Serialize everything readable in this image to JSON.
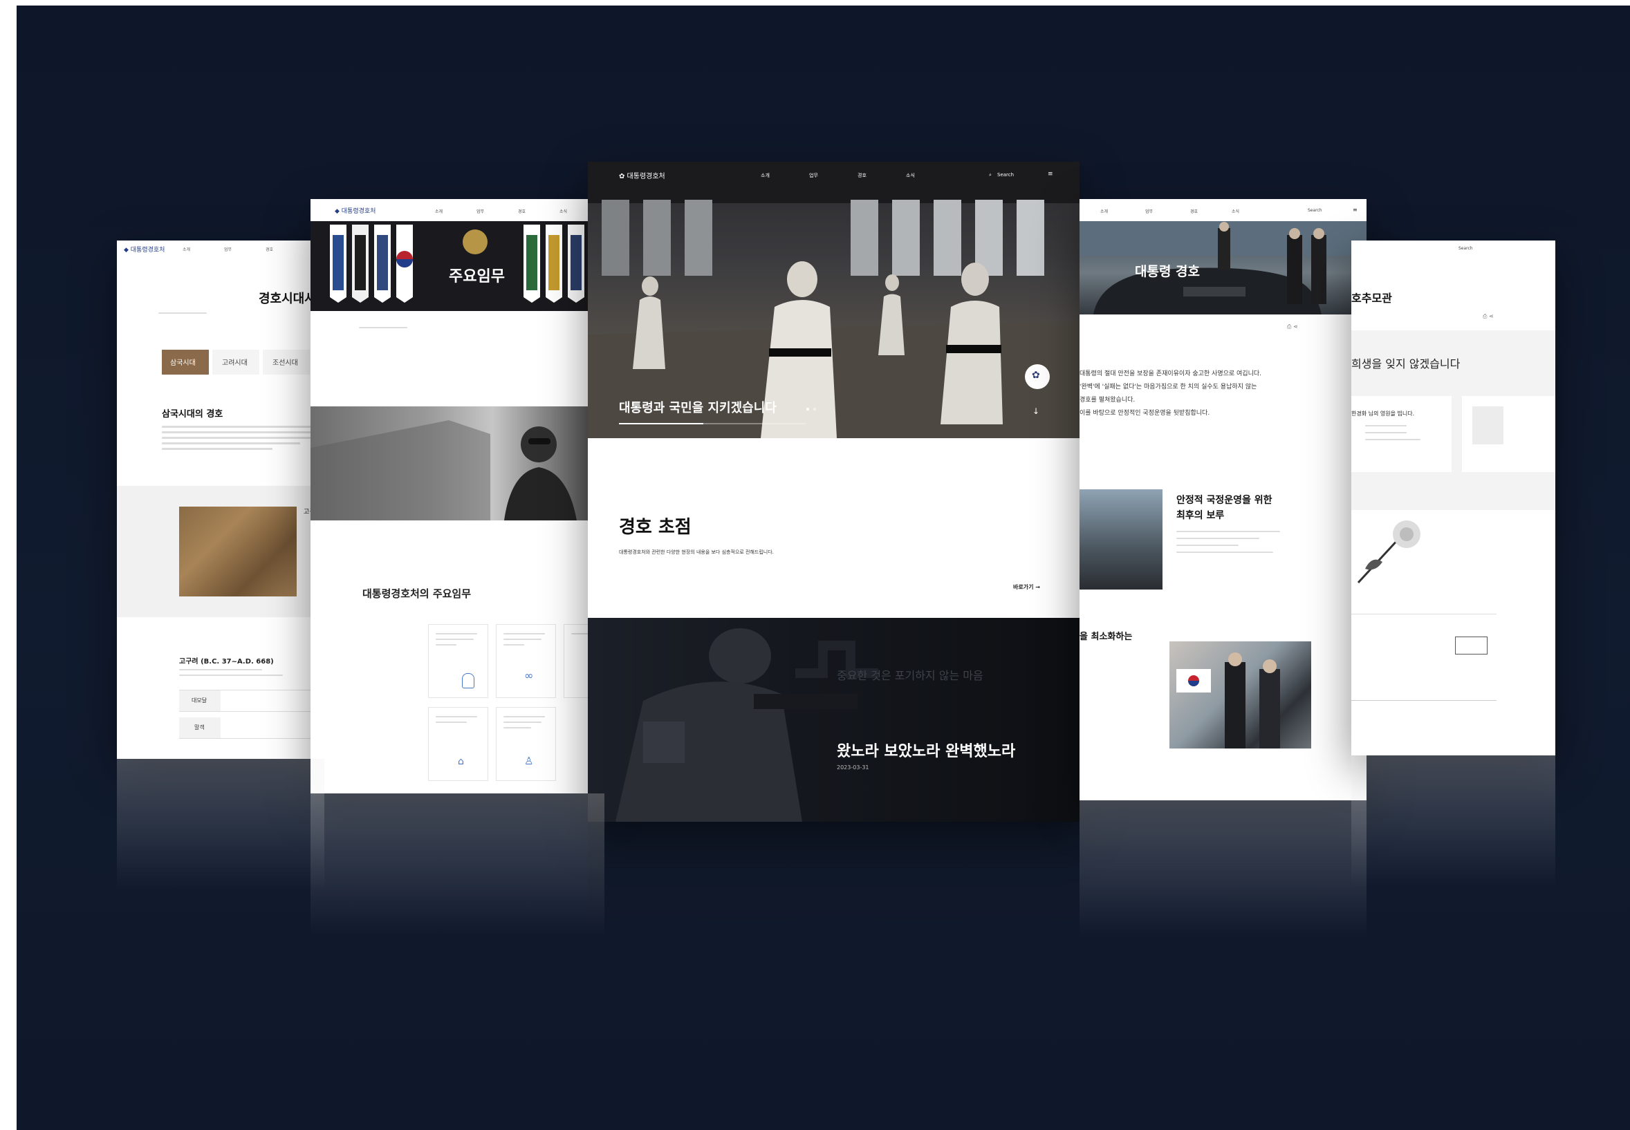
{
  "far_left_page": {
    "title": "경호시대사",
    "tabs": [
      "삼국시대",
      "고려시대",
      "조선시대"
    ],
    "section_title": "삼국시대의 경호",
    "caption_title": "고구려",
    "era": "고구려 (B.C. 37~A.D. 668)",
    "rows": [
      "대모달",
      "말객"
    ]
  },
  "left_page": {
    "hero_title": "주요임무",
    "section_title": "대통령경호처의 주요임무"
  },
  "center_page": {
    "hero_title": "대통령과 국민을 지키겠습니다",
    "focus_title": "경호 초점",
    "focus_desc": "대통령경호처와 관련한 다양한 현장의 내용을 보다 심층적으로 전해드립니다.",
    "go_link": "바로가기 →",
    "faded_quote": "중요한 것은 포기하지 않는 마음",
    "story_title": "왔노라 보았노라 완벽했노라",
    "story_date": "2023-03-31"
  },
  "right_page": {
    "hero_title": "대통령 경호",
    "intro_lines": [
      "대통령의 절대 안전을 보장을 존재이유이자 숭고한 사명으로 여깁니다.",
      "'완벽'에 '실패는 없다'는 마음가짐으로 한 치의 실수도 용납하지 않는",
      "경호를 펼쳐왔습니다.",
      "이를 바탕으로 안정적인 국정운영을 뒷받침합니다."
    ],
    "block_title_1": "안정적 국정운영을 위한",
    "block_title_2": "최후의 보루",
    "block2_title": "을 최소화하는"
  },
  "far_right_page": {
    "title": "호추모관",
    "subtitle": "희생을 잊지 않겠습니다",
    "card_title": "한경화 님의 영원을 빕니다."
  },
  "nav": {
    "search": "Search",
    "menu_items": [
      "소개",
      "업무",
      "경호",
      "소식"
    ]
  },
  "colors": {
    "background": "#0e1729",
    "page": "#ffffff",
    "dark_text": "#1a1a1a"
  }
}
